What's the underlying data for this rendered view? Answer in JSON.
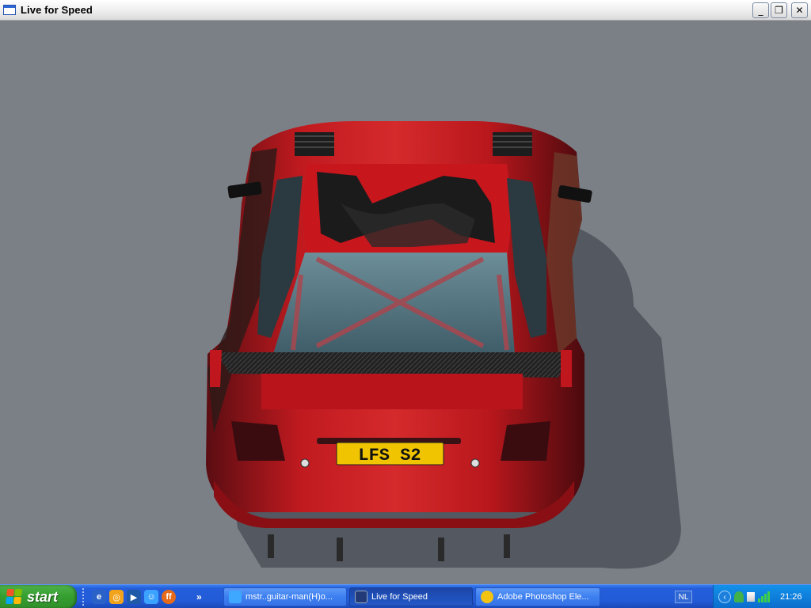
{
  "window": {
    "title": "Live for Speed",
    "minimize_symbol": "_",
    "maximize_symbol": "❐",
    "close_symbol": "✕"
  },
  "scene": {
    "license_plate": "LFS S2",
    "colors": {
      "background": "#7b8087",
      "car_body": "#c01a1f",
      "car_dark": "#2a1214",
      "plate": "#f0c400"
    }
  },
  "taskbar": {
    "start_label": "start",
    "quicklaunch_icons": [
      "internet-explorer-icon",
      "outlook-express-icon",
      "media-player-icon",
      "messenger-icon",
      "firefox-icon"
    ],
    "more_label": "»",
    "tasks": [
      {
        "label": "mstr..guitar-man(H)o...",
        "icon": "messenger-icon",
        "active": false
      },
      {
        "label": "Live for Speed",
        "icon": "lfs-icon",
        "active": true
      },
      {
        "label": "Adobe Photoshop Ele...",
        "icon": "photoshop-elements-icon",
        "active": false
      }
    ],
    "language": "NL",
    "tray_chevron": "‹",
    "clock": "21:26"
  }
}
